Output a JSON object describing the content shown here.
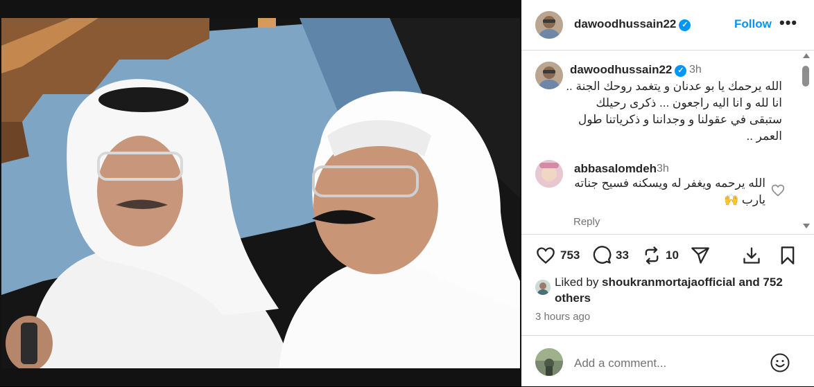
{
  "post": {
    "photo_alt": "Photo of two men in white ghutras and thobes"
  },
  "header": {
    "username": "dawoodhussain22",
    "follow_label": "Follow",
    "more_label": "•••"
  },
  "caption": {
    "username": "dawoodhussain22",
    "time": "3h",
    "text": "الله يرحمك يا بو عدنان و يتغمد روحك الجنة .. انا لله و انا اليه راجعون ... ذكرى رحيلك ستبقى في عقولنا و وجداننا و ذكرياتنا طول العمر .."
  },
  "comments": [
    {
      "username": "abbasalomdeh",
      "time": "3h",
      "text": "الله يرحمه ويغفر له ويسكنه فسيح جناته يارب 🙌",
      "reply_label": "Reply"
    }
  ],
  "actions": {
    "likes_count": "753",
    "comments_count": "33",
    "reposts_count": "10"
  },
  "likes": {
    "prefix": "Liked by ",
    "user": "shoukranmortajaofficial",
    "suffix": " and 752 others"
  },
  "posted_ago": "3 hours ago",
  "add_comment": {
    "placeholder": "Add a comment..."
  },
  "colors": {
    "accent": "#0095f6",
    "muted": "#737373",
    "border": "#dbdbdb"
  },
  "icons": [
    "verified-badge-icon",
    "more-options-icon",
    "heart-icon",
    "comment-icon",
    "repost-icon",
    "share-icon",
    "save-icon",
    "emoji-icon"
  ]
}
